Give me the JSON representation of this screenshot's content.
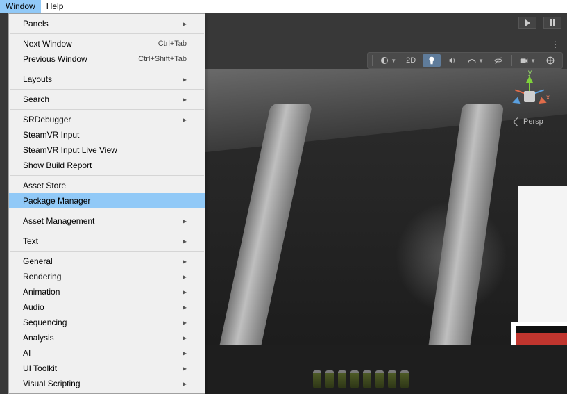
{
  "menubar": {
    "window": "Window",
    "help": "Help"
  },
  "dropdown": {
    "panels": "Panels",
    "next_window": "Next Window",
    "next_window_sc": "Ctrl+Tab",
    "prev_window": "Previous Window",
    "prev_window_sc": "Ctrl+Shift+Tab",
    "layouts": "Layouts",
    "search": "Search",
    "srdebugger": "SRDebugger",
    "steamvr_input": "SteamVR Input",
    "steamvr_input_live": "SteamVR Input Live View",
    "show_build_report": "Show Build Report",
    "asset_store": "Asset Store",
    "package_manager": "Package Manager",
    "asset_management": "Asset Management",
    "text": "Text",
    "general": "General",
    "rendering": "Rendering",
    "animation": "Animation",
    "audio": "Audio",
    "sequencing": "Sequencing",
    "analysis": "Analysis",
    "ai": "AI",
    "ui_toolkit": "UI Toolkit",
    "visual_scripting": "Visual Scripting"
  },
  "scenebar": {
    "mode_2d": "2D"
  },
  "gizmo": {
    "persp": "Persp",
    "x": "x",
    "y": "y"
  }
}
